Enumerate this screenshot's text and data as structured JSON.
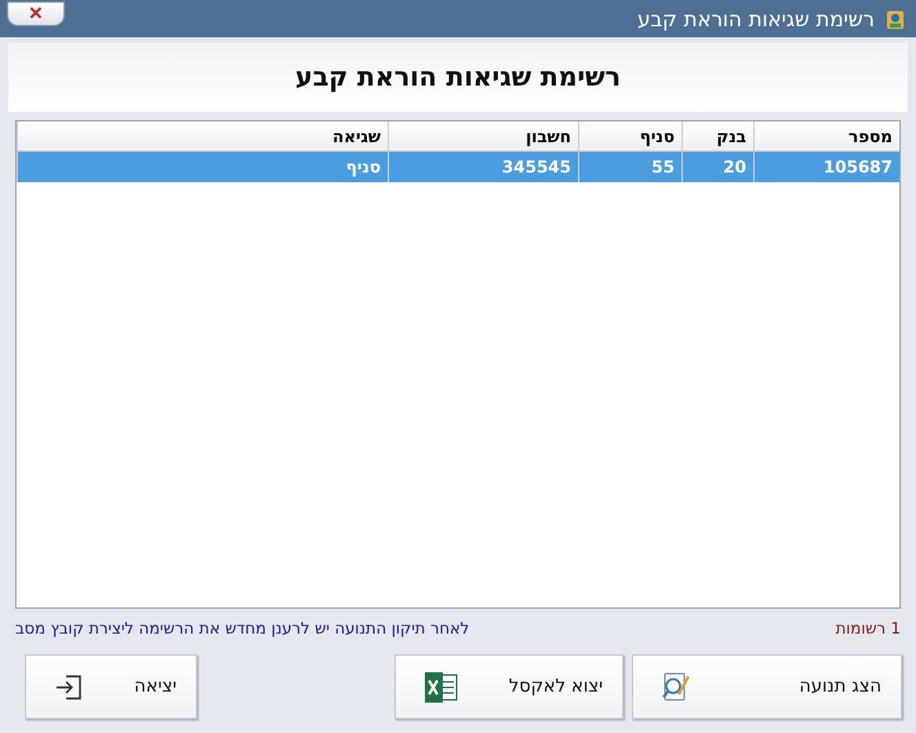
{
  "window": {
    "title": "רשימת שגיאות הוראת קבע",
    "close": "✕"
  },
  "header": {
    "title": "רשימת שגיאות הוראת קבע"
  },
  "table": {
    "columns": [
      "מספר",
      "בנק",
      "סניף",
      "חשבון",
      "שגיאה"
    ],
    "rows": [
      {
        "cells": [
          "105687",
          "20",
          "55",
          "345545",
          "סניף"
        ],
        "selected": true
      }
    ]
  },
  "status": {
    "count": "1 רשומות",
    "note": "לאחר תיקון התנועה יש לרענן מחדש את הרשימה ליצירת קובץ מסב"
  },
  "buttons": [
    {
      "label": "הצג תנועה",
      "kind": "show"
    },
    {
      "label": "יצוא לאקסל",
      "kind": "excel"
    },
    {
      "label": "יציאה",
      "kind": "exit"
    }
  ]
}
